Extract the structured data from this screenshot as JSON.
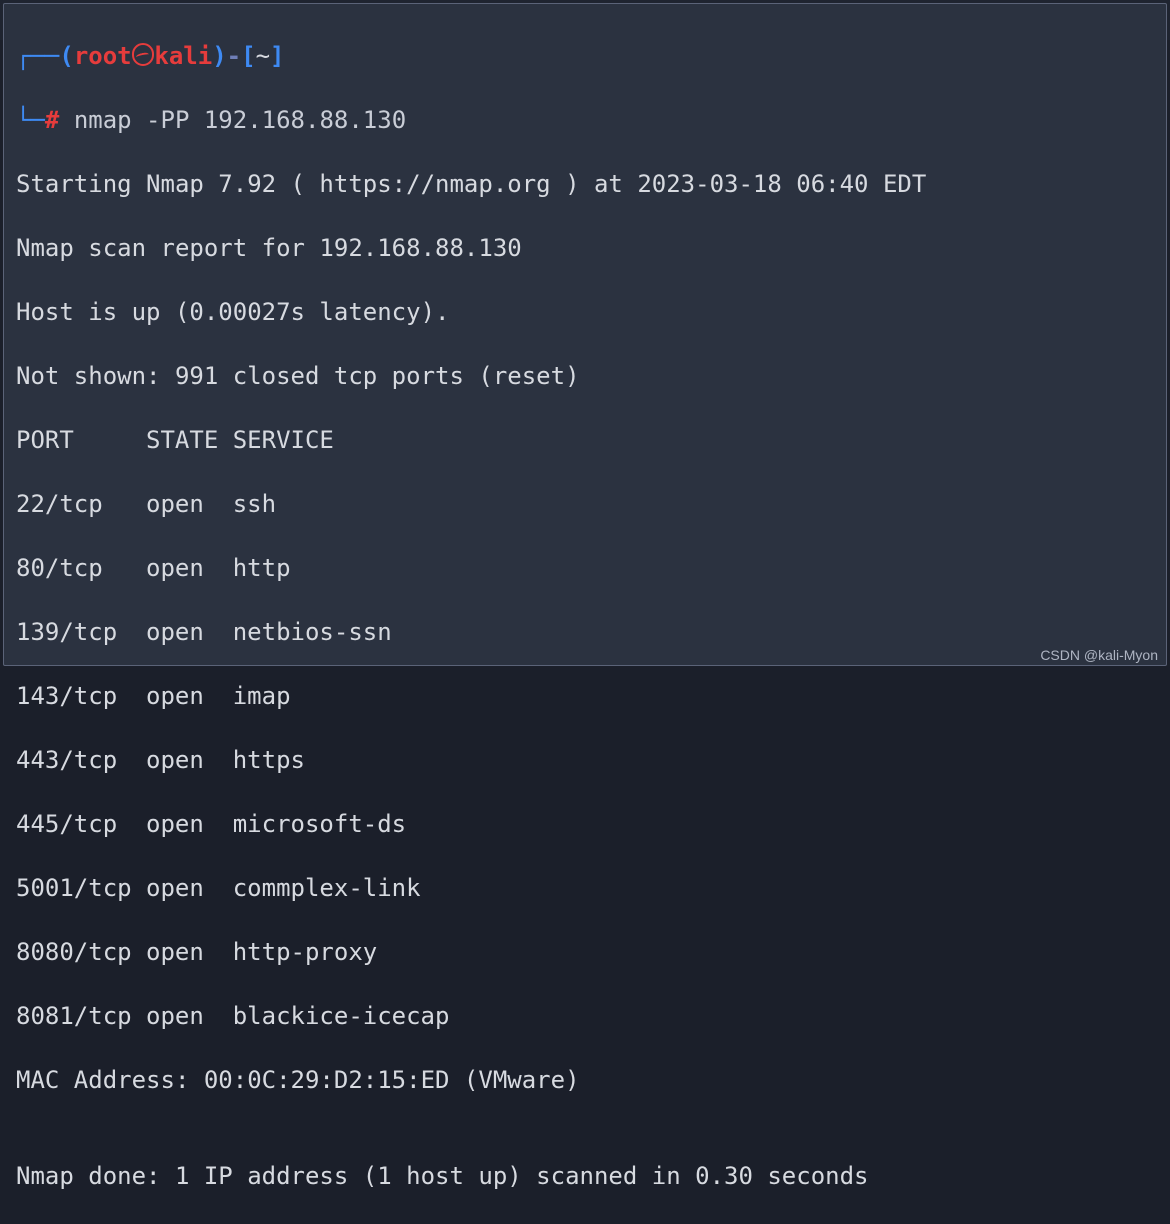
{
  "prompt": {
    "corner_left": "┌──",
    "lparen": "(",
    "user": "root",
    "at_icon_name": "kali-skull-icon",
    "host": "kali",
    "rparen": ")",
    "dash": "-",
    "lbr": "[",
    "cwd": "~",
    "rbr": "]",
    "corner_down": "└─",
    "hash": "#",
    "command": "nmap -PP 192.168.88.130"
  },
  "output": {
    "line_start": "Starting Nmap 7.92 ( https://nmap.org ) at 2023-03-18 06:40 EDT",
    "line_report": "Nmap scan report for 192.168.88.130",
    "line_host": "Host is up (0.00027s latency).",
    "line_notshown": "Not shown: 991 closed tcp ports (reset)",
    "header": {
      "port": "PORT",
      "state": "STATE",
      "service": "SERVICE"
    },
    "ports": [
      {
        "port": "22/tcp",
        "state": "open",
        "service": "ssh"
      },
      {
        "port": "80/tcp",
        "state": "open",
        "service": "http"
      },
      {
        "port": "139/tcp",
        "state": "open",
        "service": "netbios-ssn"
      },
      {
        "port": "143/tcp",
        "state": "open",
        "service": "imap"
      },
      {
        "port": "443/tcp",
        "state": "open",
        "service": "https"
      },
      {
        "port": "445/tcp",
        "state": "open",
        "service": "microsoft-ds"
      },
      {
        "port": "5001/tcp",
        "state": "open",
        "service": "commplex-link"
      },
      {
        "port": "8080/tcp",
        "state": "open",
        "service": "http-proxy"
      },
      {
        "port": "8081/tcp",
        "state": "open",
        "service": "blackice-icecap"
      }
    ],
    "line_mac": "MAC Address: 00:0C:29:D2:15:ED (VMware)",
    "blank": "",
    "line_done": "Nmap done: 1 IP address (1 host up) scanned in 0.30 seconds"
  },
  "watermark": "CSDN @kali-Myon"
}
